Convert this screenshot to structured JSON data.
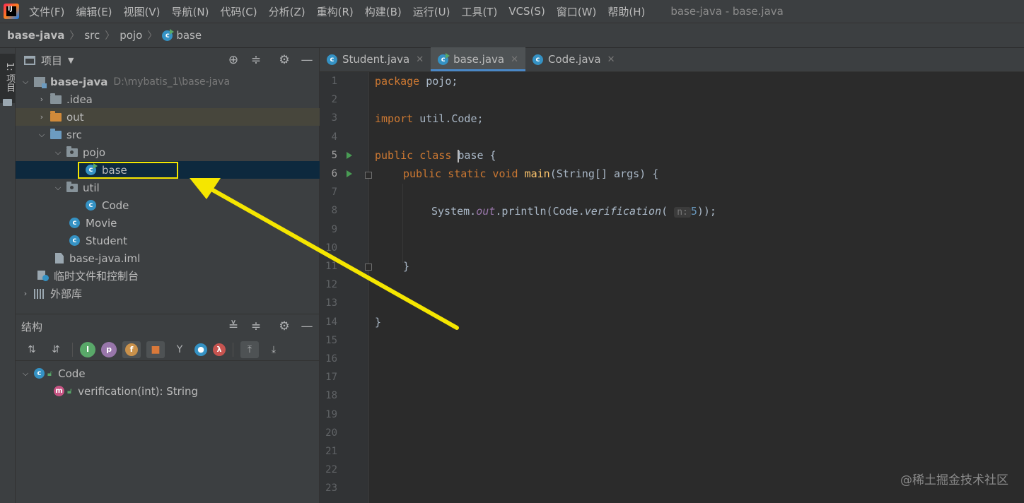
{
  "menubar": {
    "items": [
      "文件(F)",
      "编辑(E)",
      "视图(V)",
      "导航(N)",
      "代码(C)",
      "分析(Z)",
      "重构(R)",
      "构建(B)",
      "运行(U)",
      "工具(T)",
      "VCS(S)",
      "窗口(W)",
      "帮助(H)"
    ],
    "window_title": "base-java - base.java"
  },
  "breadcrumb": [
    "base-java",
    "src",
    "pojo",
    "base"
  ],
  "left_strip": {
    "label": "1: 项目"
  },
  "project_panel": {
    "title": "项目",
    "tree": [
      {
        "label": "base-java",
        "path": "D:\\mybatis_1\\base-java"
      },
      {
        "label": ".idea"
      },
      {
        "label": "out"
      },
      {
        "label": "src"
      },
      {
        "label": "pojo"
      },
      {
        "label": "base"
      },
      {
        "label": "util"
      },
      {
        "label": "Code"
      },
      {
        "label": "Movie"
      },
      {
        "label": "Student"
      },
      {
        "label": "base-java.iml"
      },
      {
        "label": "临时文件和控制台"
      },
      {
        "label": "外部库"
      }
    ]
  },
  "structure_panel": {
    "title": "结构",
    "items": [
      {
        "label": "Code"
      },
      {
        "label": "verification(int): String"
      }
    ]
  },
  "editor": {
    "tabs": [
      "Student.java",
      "base.java",
      "Code.java"
    ],
    "active_tab": "base.java",
    "line_numbers": [
      "1",
      "2",
      "3",
      "4",
      "5",
      "6",
      "7",
      "8",
      "9",
      "10",
      "11",
      "12",
      "13",
      "14",
      "15",
      "16",
      "17",
      "18",
      "19",
      "20",
      "21",
      "22",
      "23"
    ],
    "code": {
      "l1_kw": "package",
      "l1_rest": " pojo;",
      "l3_kw": "import",
      "l3_rest": " util.Code;",
      "l5_kw": "public class ",
      "l5_name": "base",
      "l5_rest": " {",
      "l6_kw": "public static void ",
      "l6_fn": "main",
      "l6_rest": "(String[] args) {",
      "l8_a": "System.",
      "l8_field": "out",
      "l8_b": ".println(Code.",
      "l8_method": "verification",
      "l8_c": "(",
      "l8_hint": "n:",
      "l8_num": "5",
      "l8_d": "));",
      "l11": "}",
      "l14": "}"
    }
  },
  "watermark": "@稀土掘金技术社区",
  "colors": {
    "annotation_yellow": "#f5e600",
    "accent": "#4a88c7",
    "selection": "#0d293e"
  }
}
